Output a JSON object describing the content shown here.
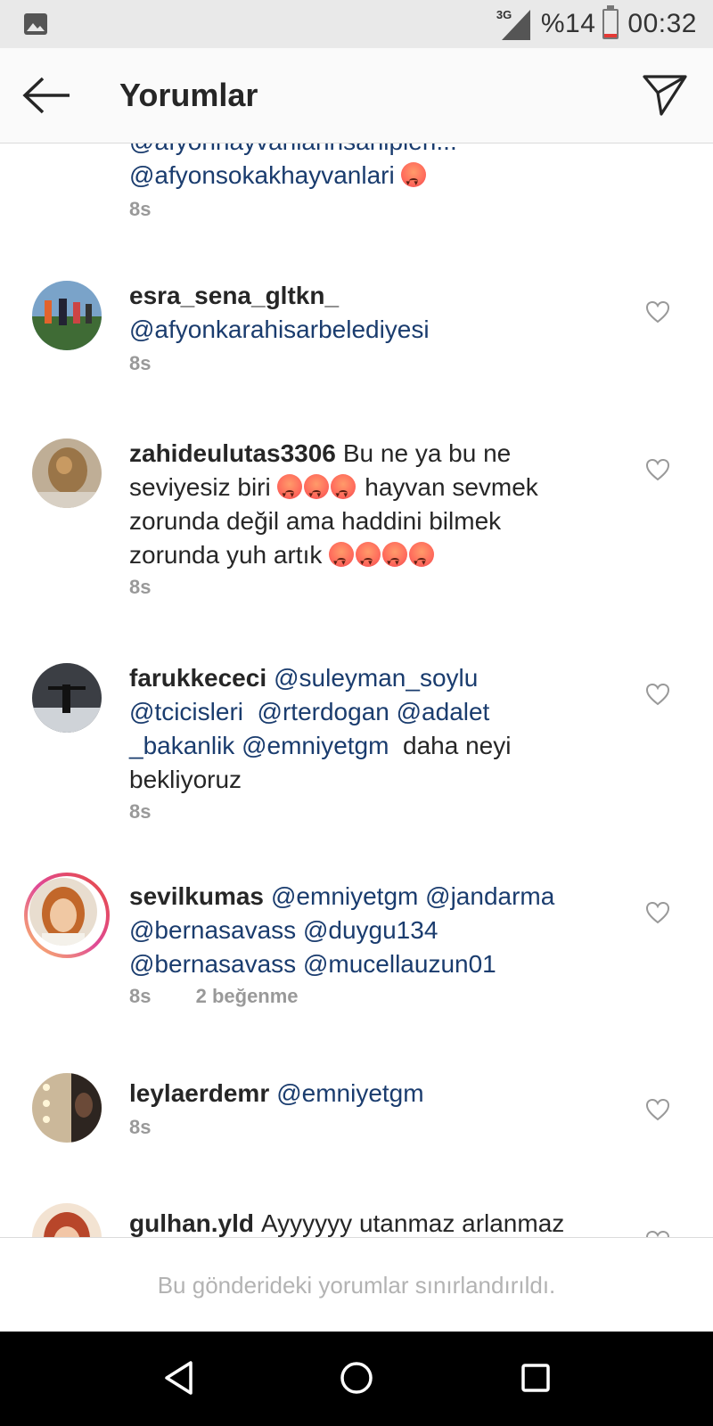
{
  "status_bar": {
    "network": "3G",
    "battery": "%14",
    "battery_level": 0.14,
    "time": "00:32"
  },
  "header": {
    "title": "Yorumlar"
  },
  "comments": [
    {
      "username": "",
      "text_top": "@afyonhayvanlarinsahipleri...",
      "mention": "@afyonsokakhayvanlari",
      "time": "8s"
    },
    {
      "username": "esra_sena_gltkn_",
      "mention": "@afyonkarahisarbelediyesi",
      "time": "8s"
    },
    {
      "username": "zahideulutas3306",
      "line1": "Bu ne ya bu ne",
      "line2": "seviyesiz biri",
      "line2b": "hayvan sevmek",
      "line3": "zorunda değil ama haddini bilmek",
      "line4": "zorunda yuh artık",
      "time": "8s"
    },
    {
      "username": "farukkececi",
      "m1": "@suleyman_soylu",
      "m2": "@tcicisleri",
      "m3": "@rterdogan",
      "m4": "@adalet",
      "m5": "_bakanlik",
      "m6": "@emniyetgm",
      "t1": "daha neyi",
      "t2": "bekliyoruz",
      "time": "8s"
    },
    {
      "username": "sevilkumas",
      "m1": "@emniyetgm",
      "m2": "@jandarma",
      "m3": "@bernasavass",
      "m4": "@duygu134",
      "m5": "@bernasavass",
      "m6": "@mucellauzun01",
      "time": "8s",
      "likes": "2 beğenme"
    },
    {
      "username": "leylaerdemr",
      "mention": "@emniyetgm",
      "time": "8s"
    },
    {
      "username": "gulhan.yld",
      "text": "Ayyyyyy utanmaz arlanmaz"
    }
  ],
  "footer": {
    "restricted_text": "Bu gönderideki yorumlar sınırlandırıldı."
  },
  "colors": {
    "mention": "#1a3c6e",
    "meta": "#999999",
    "story_ring": "#df4996"
  }
}
